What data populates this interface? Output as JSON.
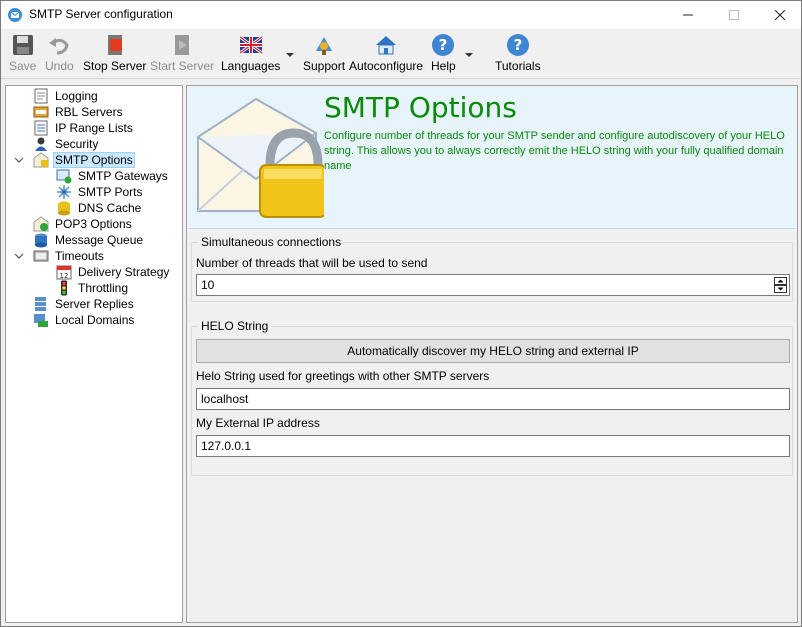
{
  "window": {
    "title": "SMTP Server configuration"
  },
  "toolbar": {
    "save": "Save",
    "undo": "Undo",
    "stop_server": "Stop Server",
    "start_server": "Start Server",
    "languages": "Languages",
    "support": "Support",
    "autoconfigure": "Autoconfigure",
    "help": "Help",
    "tutorials": "Tutorials"
  },
  "tree": {
    "items": [
      {
        "label": "Logging",
        "icon": "log-icon"
      },
      {
        "label": "RBL Servers",
        "icon": "rbl-icon"
      },
      {
        "label": "IP Range Lists",
        "icon": "ip-range-icon"
      },
      {
        "label": "Security",
        "icon": "security-icon"
      },
      {
        "label": "SMTP Options",
        "icon": "smtp-options-icon"
      },
      {
        "label": "SMTP Gateways",
        "icon": "gateway-icon"
      },
      {
        "label": "SMTP Ports",
        "icon": "ports-icon"
      },
      {
        "label": "DNS Cache",
        "icon": "dns-icon"
      },
      {
        "label": "POP3 Options",
        "icon": "pop3-icon"
      },
      {
        "label": "Message Queue",
        "icon": "queue-icon"
      },
      {
        "label": "Timeouts",
        "icon": "timeouts-icon"
      },
      {
        "label": "Delivery Strategy",
        "icon": "calendar-icon"
      },
      {
        "label": "Throttling",
        "icon": "traffic-light-icon"
      },
      {
        "label": "Server Replies",
        "icon": "server-icon"
      },
      {
        "label": "Local Domains",
        "icon": "domain-icon"
      }
    ]
  },
  "header": {
    "title": "SMTP Options",
    "description": "Configure number of threads for your SMTP sender and configure autodiscovery of your HELO string. This allows you to always correctly emit the HELO string with your fully qualified domain name"
  },
  "connections": {
    "group_title": "Simultaneous connections",
    "threads_label": "Number of threads that will be used to send",
    "threads_value": "10"
  },
  "helo": {
    "group_title": "HELO String",
    "discover_button": "Automatically discover my HELO string and external IP",
    "helo_label": "Helo String used for greetings with other SMTP servers",
    "helo_value": "localhost",
    "ip_label": "My External IP address",
    "ip_value": "127.0.0.1"
  },
  "colors": {
    "accent_green": "#0a8a0a",
    "header_bg": "#e7f4fb",
    "selection": "#cce8ff"
  }
}
